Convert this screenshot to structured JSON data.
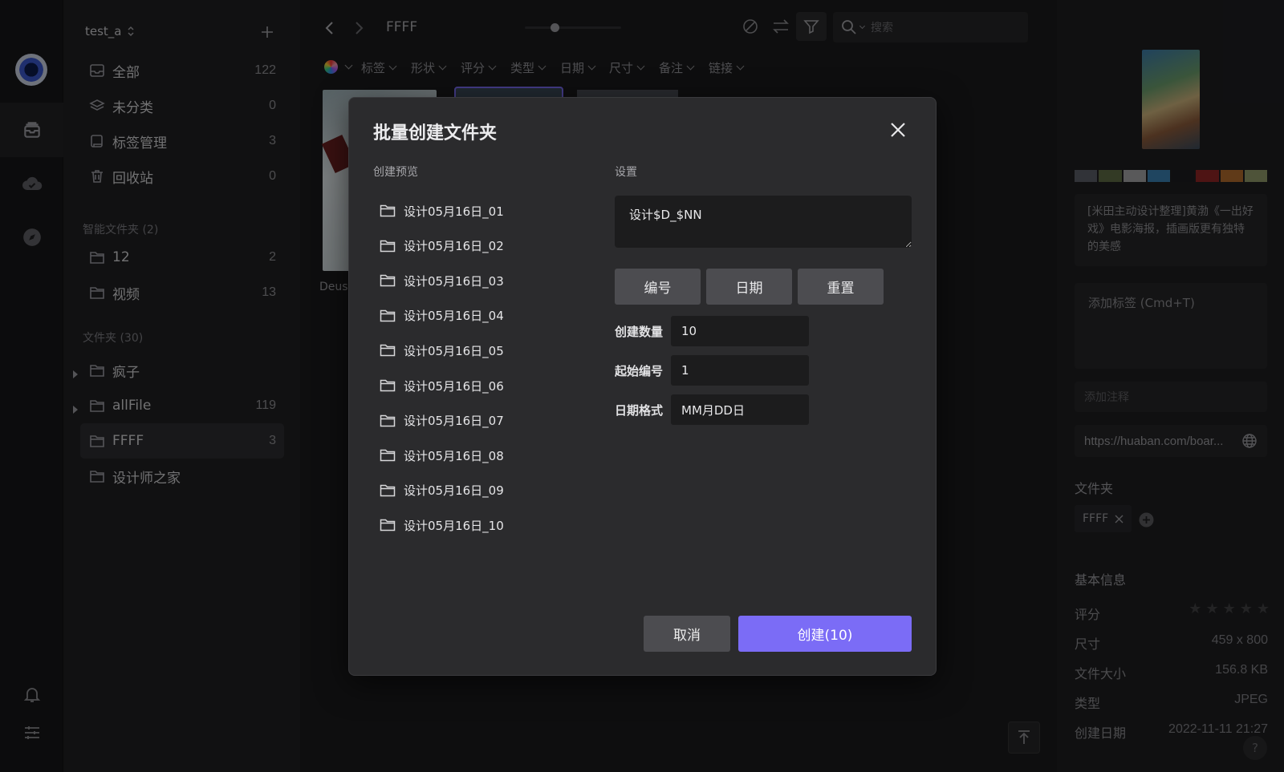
{
  "window": {
    "traffic_lights": [
      "#ff5f57",
      "#febc2e",
      "#28c840"
    ]
  },
  "sidebar": {
    "library_name": "test_a",
    "items": [
      {
        "label": "全部",
        "count": "122"
      },
      {
        "label": "未分类",
        "count": "0"
      },
      {
        "label": "标签管理",
        "count": "3"
      },
      {
        "label": "回收站",
        "count": "0"
      }
    ],
    "smart_header": "智能文件夹 (2)",
    "smart_items": [
      {
        "label": "12",
        "count": "2"
      },
      {
        "label": "视频",
        "count": "13"
      }
    ],
    "folder_header": "文件夹 (30)",
    "folders": [
      {
        "label": "疯子",
        "count": ""
      },
      {
        "label": "allFile",
        "count": "119"
      },
      {
        "label": "FFFF",
        "count": "3"
      },
      {
        "label": "设计师之家",
        "count": ""
      }
    ]
  },
  "toolbar": {
    "folder_title": "FFFF",
    "search_placeholder": "搜索",
    "filters": [
      "标签",
      "形状",
      "评分",
      "类型",
      "日期",
      "尺寸",
      "备注",
      "链接"
    ]
  },
  "grid": {
    "partial_caption": "Deus"
  },
  "dialog": {
    "title": "批量创建文件夹",
    "preview_header": "创建预览",
    "settings_header": "设置",
    "preview_items": [
      "设计05月16日_01",
      "设计05月16日_02",
      "设计05月16日_03",
      "设计05月16日_04",
      "设计05月16日_05",
      "设计05月16日_06",
      "设计05月16日_07",
      "设计05月16日_08",
      "设计05月16日_09",
      "设计05月16日_10"
    ],
    "pattern": "设计$D_$NN",
    "tokens": [
      "编号",
      "日期",
      "重置"
    ],
    "fields": [
      {
        "label": "创建数量",
        "value": "10"
      },
      {
        "label": "起始编号",
        "value": "1"
      },
      {
        "label": "日期格式",
        "value": "MM月DD日"
      }
    ],
    "cancel_label": "取消",
    "create_label": "创建(10)"
  },
  "inspector": {
    "palette": [
      "#5a5d66",
      "#5d6b44",
      "#a2a3a5",
      "#3a7fb0",
      "#1c1c1f",
      "#8e2525",
      "#b06a2c",
      "#8f9868"
    ],
    "description": "[米田主动设计整理]黄渤《一出好戏》电影海报，插画版更有独特的美感",
    "tag_placeholder": "添加标签 (Cmd+T)",
    "note_placeholder": "添加注释",
    "url": "https://huaban.com/boar...",
    "folder_section": "文件夹",
    "folder_chip": "FFFF",
    "basic_info": "基本信息",
    "rating_label": "评分",
    "size_label": "尺寸",
    "size_value": "459 x 800",
    "filesize_label": "文件大小",
    "filesize_value": "156.8 KB",
    "type_label": "类型",
    "type_value": "JPEG",
    "created_label": "创建日期",
    "created_value": "2022-11-11 21:27"
  },
  "colors": {
    "accent": "#7b6cf6"
  }
}
